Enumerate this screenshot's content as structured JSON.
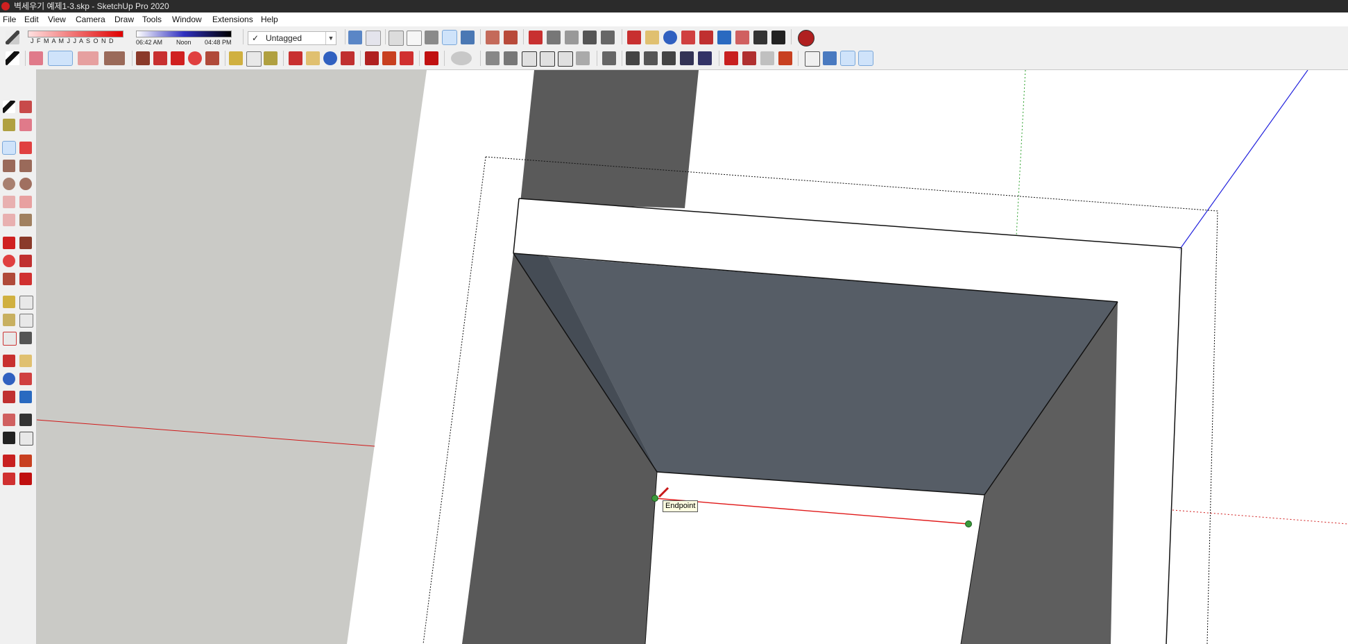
{
  "window": {
    "title": "벽세우기 예제1-3.skp - SketchUp Pro 2020"
  },
  "menu": [
    "File",
    "Edit",
    "View",
    "Camera",
    "Draw",
    "Tools",
    "Window",
    "Extensions",
    "Help"
  ],
  "shadows": {
    "months": "J F M A M J J A S O N D",
    "time_start": "06:42 AM",
    "time_noon": "Noon",
    "time_end": "04:48 PM"
  },
  "tag_selector": {
    "check": "✓",
    "value": "Untagged"
  },
  "toolbar_row1_icons": [
    "eraser-icon",
    "monochrome-style-icon",
    "wireframe-style-icon",
    "hidden-line-style-icon",
    "shaded-style-icon",
    "shaded-texture-style-icon",
    "monochrome-icon",
    "xray-icon",
    "back-edges-icon",
    "orbit-icon",
    "pan-icon",
    "zoom-icon",
    "zoom-window-icon",
    "zoom-extents-icon",
    "previous-view-icon",
    "position-camera-icon",
    "look-around-icon",
    "walk-icon",
    "geo-location-icon"
  ],
  "toolbar_row2_icons": [
    "select-icon",
    "eraser-icon",
    "line-icon",
    "arc-icon",
    "rectangle-icon",
    "push-pull-icon",
    "follow-me-icon",
    "move-icon",
    "rotate-icon",
    "scale-icon",
    "tape-measure-icon",
    "text-icon",
    "paint-bucket-icon",
    "orbit-icon",
    "pan-icon",
    "zoom-extents-icon",
    "warehouse-icon",
    "extension-warehouse-icon",
    "section-plane-icon",
    "ruby-console-icon",
    "iso-view-icon",
    "top-view-icon",
    "front-view-icon",
    "right-view-icon",
    "back-view-icon",
    "left-view-icon",
    "section-fill-icon",
    "section-cuts-icon",
    "sandbox-icon",
    "sandbox-contours-icon",
    "drape-icon",
    "stamp-icon",
    "smoove-icon",
    "add-detail-icon",
    "flip-edge-icon",
    "axes-icon",
    "iso-icon",
    "perspective-icon",
    "two-point-icon"
  ],
  "left_toolbar_icons": [
    "select-icon",
    "make-component-icon",
    "paint-bucket-icon",
    "eraser-icon",
    "line-icon",
    "freehand-icon",
    "rectangle-icon",
    "rotated-rectangle-icon",
    "circle-icon",
    "polygon-icon",
    "arc-icon",
    "two-point-arc-icon",
    "three-point-arc-icon",
    "pie-icon",
    "move-icon",
    "push-pull-icon",
    "rotate-icon",
    "follow-me-icon",
    "scale-icon",
    "offset-icon",
    "tape-measure-icon",
    "dimension-icon",
    "protractor-icon",
    "text-icon",
    "axes-icon",
    "3d-text-icon",
    "orbit-icon",
    "pan-icon",
    "zoom-icon",
    "zoom-window-icon",
    "zoom-extents-icon",
    "previous-icon",
    "position-camera-icon",
    "look-around-icon",
    "walk-icon",
    "section-plane-icon",
    "warehouse-icon",
    "extension-warehouse-icon",
    "send-to-layout-icon",
    "ruby-icon"
  ],
  "inference": {
    "tooltip": "Endpoint"
  },
  "colors": {
    "red_axis": "#d01818",
    "green_axis": "#2aa02a",
    "blue_axis": "#2222dd",
    "wall_dark": "#5a5a5a",
    "ceiling": "#565d66",
    "ground_gray": "#cacac6",
    "inference_point": "#3a9a3a"
  }
}
